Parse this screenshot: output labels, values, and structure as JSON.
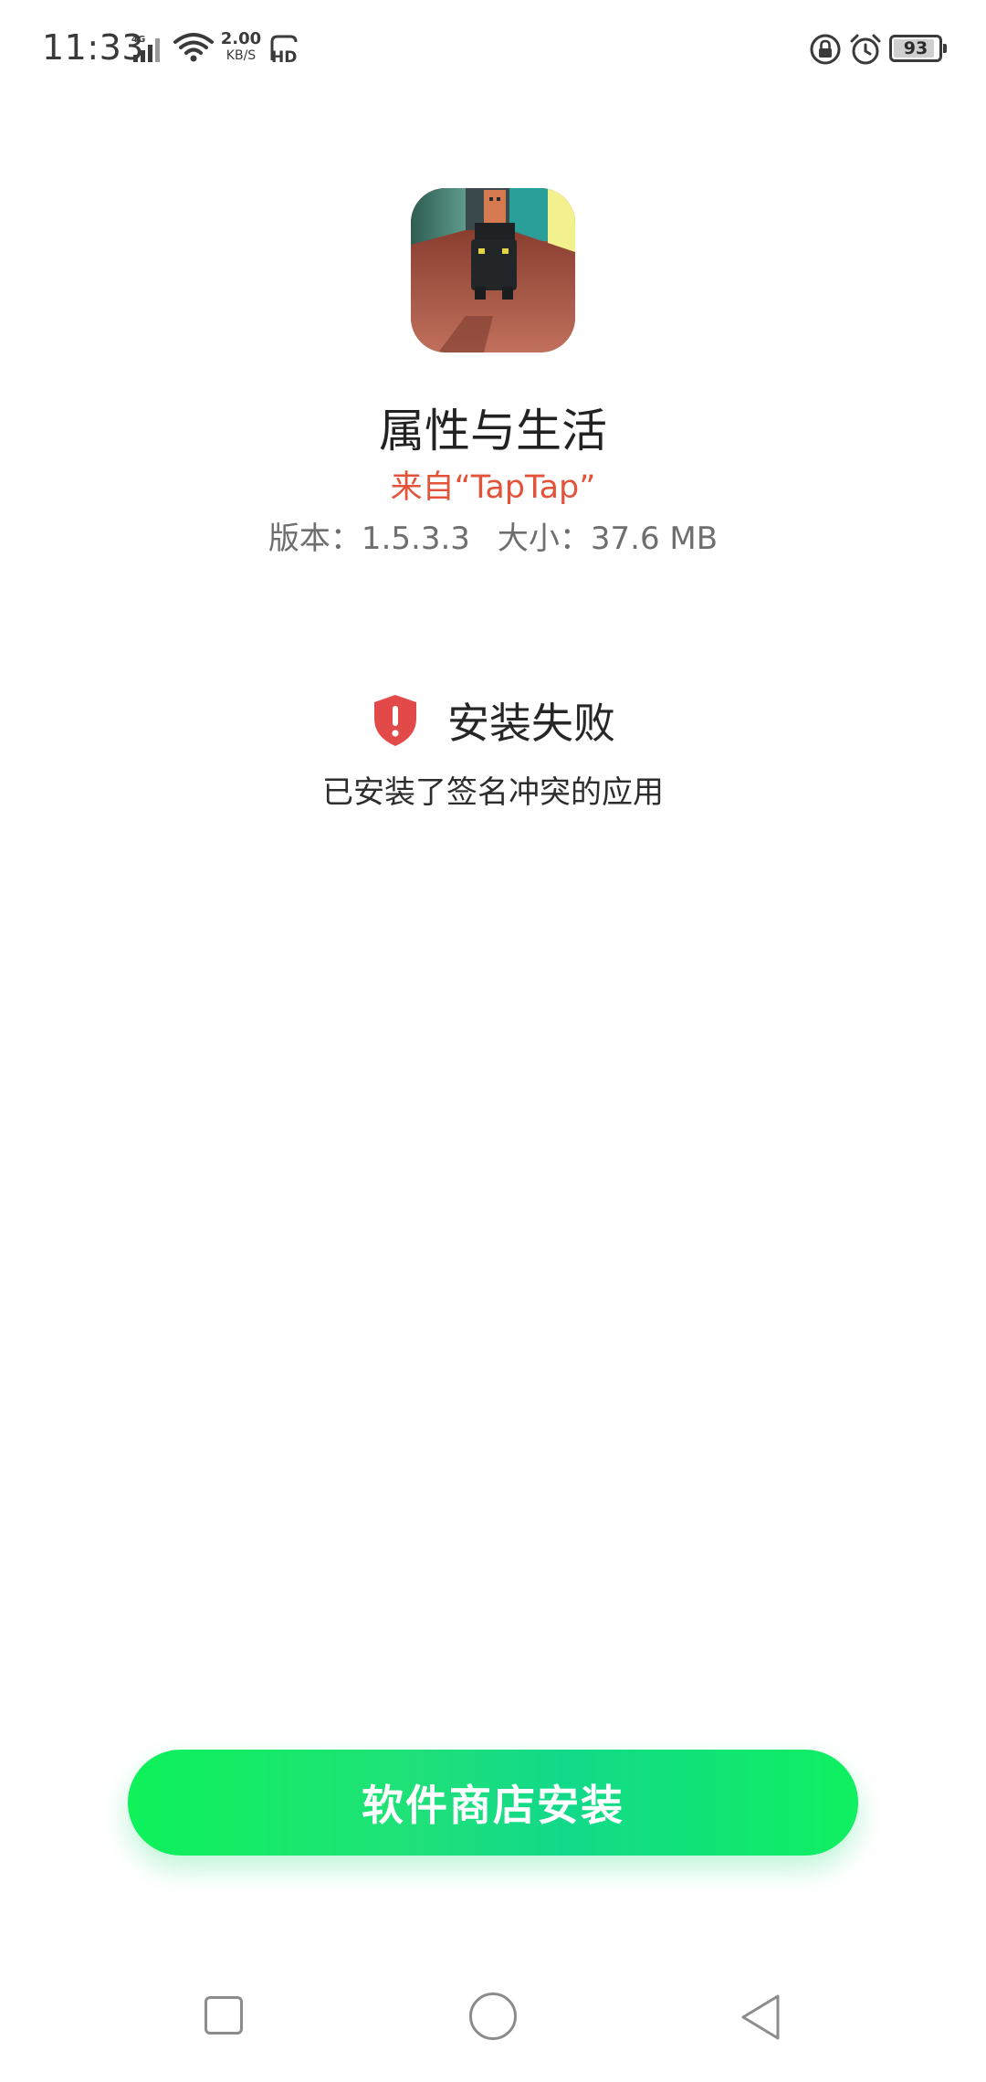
{
  "status_bar": {
    "time": "11:33",
    "network_type": "4G",
    "net_speed_value": "2.00",
    "net_speed_unit": "KB/S",
    "hd_label": "HD",
    "battery_level": "93",
    "icons": [
      "signal-icon",
      "wifi-icon",
      "hd-icon",
      "rotation-lock-icon",
      "alarm-icon",
      "battery-icon"
    ]
  },
  "app": {
    "name": "属性与生活",
    "source": "来自“TapTap”",
    "version_text": "版本：1.5.3.3",
    "size_text": "大小：37.6 MB",
    "icon": "game-app-icon"
  },
  "result": {
    "title": "安装失败",
    "detail": "已安装了签名冲突的应用",
    "icon": "error-shield-icon",
    "accent_color": "#e24a4a"
  },
  "actions": {
    "install_store_label": "软件商店安装",
    "button_color": "#12e07a"
  },
  "navigation": {
    "icons": [
      "recent-apps-icon",
      "home-icon",
      "back-icon"
    ]
  }
}
